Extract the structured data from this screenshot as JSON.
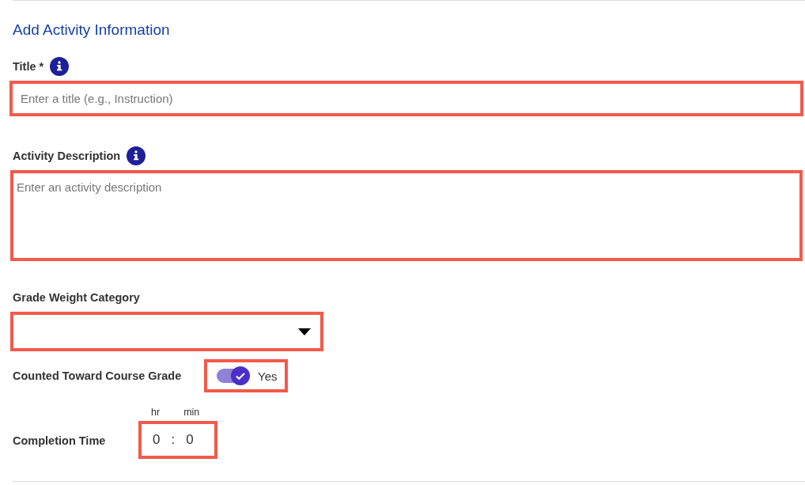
{
  "heading": "Add Activity Information",
  "fields": [
    {
      "kind": "text",
      "label": "Title *",
      "info": true,
      "placeholder": "Enter a title (e.g., Instruction)",
      "highlighted": true
    },
    {
      "kind": "textarea",
      "label": "Activity Description",
      "info": true,
      "placeholder": "Enter an activity description",
      "highlighted": true
    },
    {
      "kind": "select",
      "label": "Grade Weight Category",
      "info": false,
      "highlighted": true
    }
  ],
  "counted": {
    "label": "Counted Toward Course Grade",
    "on": true,
    "value_label": "Yes",
    "highlighted": true
  },
  "completion_time": {
    "label": "Completion Time",
    "hours_label": "hr",
    "minutes_label": "min",
    "hours": "0",
    "separator": ":",
    "minutes": "0",
    "highlighted": true
  }
}
